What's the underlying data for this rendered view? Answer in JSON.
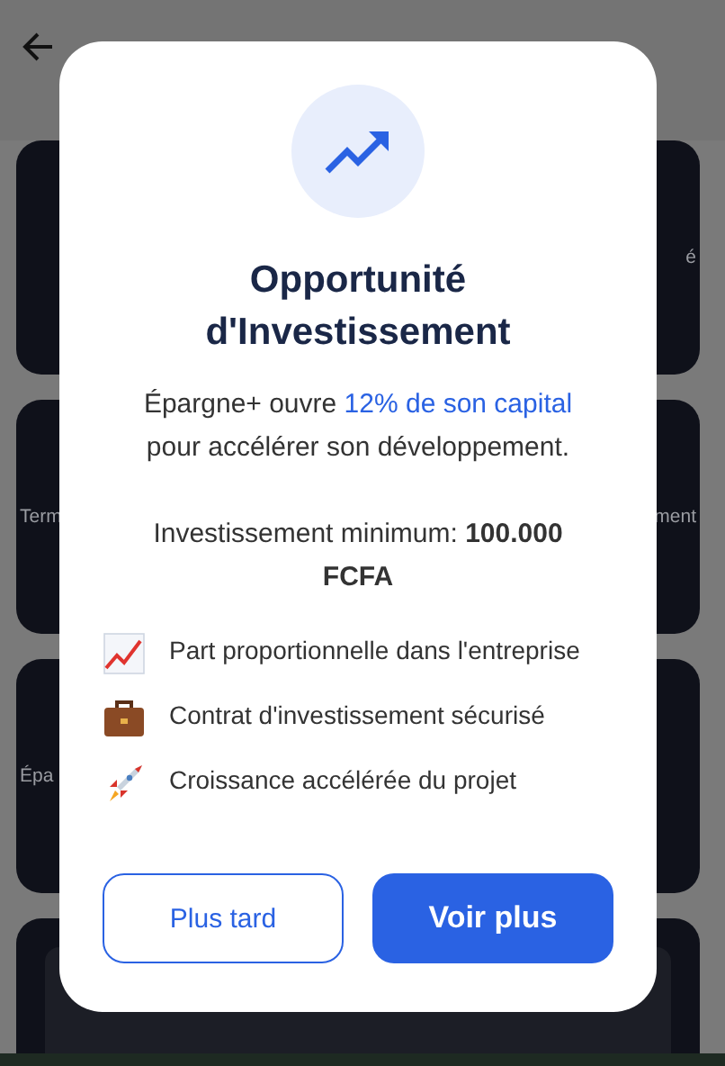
{
  "background": {
    "cards": [
      {
        "right_text": "é"
      },
      {
        "left_text": "Term",
        "right_text": "ment"
      },
      {
        "left_text": "Épa"
      },
      {
        "kind": "nav"
      }
    ]
  },
  "modal": {
    "title": "Opportunité d'Investissement",
    "description": "Épargne+ ouvre **12% de son capital** pour accélérer son développement.",
    "minimum": "Investissement minimum: **100.000 FCFA**",
    "features": [
      {
        "kind": "chart",
        "text": "Part proportionnelle dans l'entreprise"
      },
      {
        "kind": "briefcase",
        "text": "Contrat d'investissement sécurisé"
      },
      {
        "kind": "rocket",
        "text": "Croissance accélérée du projet"
      }
    ],
    "buttons": [
      {
        "label": "Plus tard",
        "kind": "outline"
      },
      {
        "label": "Voir plus",
        "kind": "primary"
      }
    ]
  }
}
